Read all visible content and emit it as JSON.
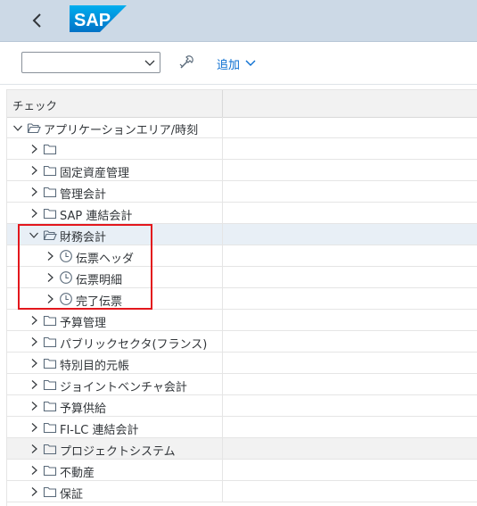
{
  "shell": {
    "logo_text": "SAP",
    "back_icon": "chevron-left-icon"
  },
  "toolbar": {
    "combo_value": "",
    "tool_icon": "wrench-icon",
    "add_label": "追加"
  },
  "tree": {
    "column_header": "チェック",
    "rows": [
      {
        "label": "アプリケーションエリア/時刻",
        "expanded": true,
        "icon": "folder-open-icon"
      },
      {
        "label": "",
        "expanded": false,
        "icon": "folder-icon"
      },
      {
        "label": "固定資産管理",
        "expanded": false,
        "icon": "folder-icon"
      },
      {
        "label": "管理会計",
        "expanded": false,
        "icon": "folder-icon"
      },
      {
        "label": "SAP 連結会計",
        "expanded": false,
        "icon": "folder-icon"
      },
      {
        "label": "財務会計",
        "expanded": true,
        "icon": "folder-open-icon"
      },
      {
        "label": "伝票ヘッダ",
        "expanded": false,
        "icon": "clock-icon"
      },
      {
        "label": "伝票明細",
        "expanded": false,
        "icon": "clock-icon"
      },
      {
        "label": "完了伝票",
        "expanded": false,
        "icon": "clock-icon"
      },
      {
        "label": "予算管理",
        "expanded": false,
        "icon": "folder-icon"
      },
      {
        "label": "パブリックセクタ(フランス)",
        "expanded": false,
        "icon": "folder-icon"
      },
      {
        "label": "特別目的元帳",
        "expanded": false,
        "icon": "folder-icon"
      },
      {
        "label": "ジョイントベンチャ会計",
        "expanded": false,
        "icon": "folder-icon"
      },
      {
        "label": "予算供給",
        "expanded": false,
        "icon": "folder-icon"
      },
      {
        "label": "FI-LC 連結会計",
        "expanded": false,
        "icon": "folder-icon"
      },
      {
        "label": "プロジェクトシステム",
        "expanded": false,
        "icon": "folder-icon"
      },
      {
        "label": "不動産",
        "expanded": false,
        "icon": "folder-icon"
      },
      {
        "label": "保証",
        "expanded": false,
        "icon": "folder-icon"
      }
    ]
  },
  "colors": {
    "shell_bg": "#ccd9e6",
    "logo_blue": "#0a6ed1",
    "highlight": "#e3171d",
    "selected_row": "#e8eff6"
  }
}
